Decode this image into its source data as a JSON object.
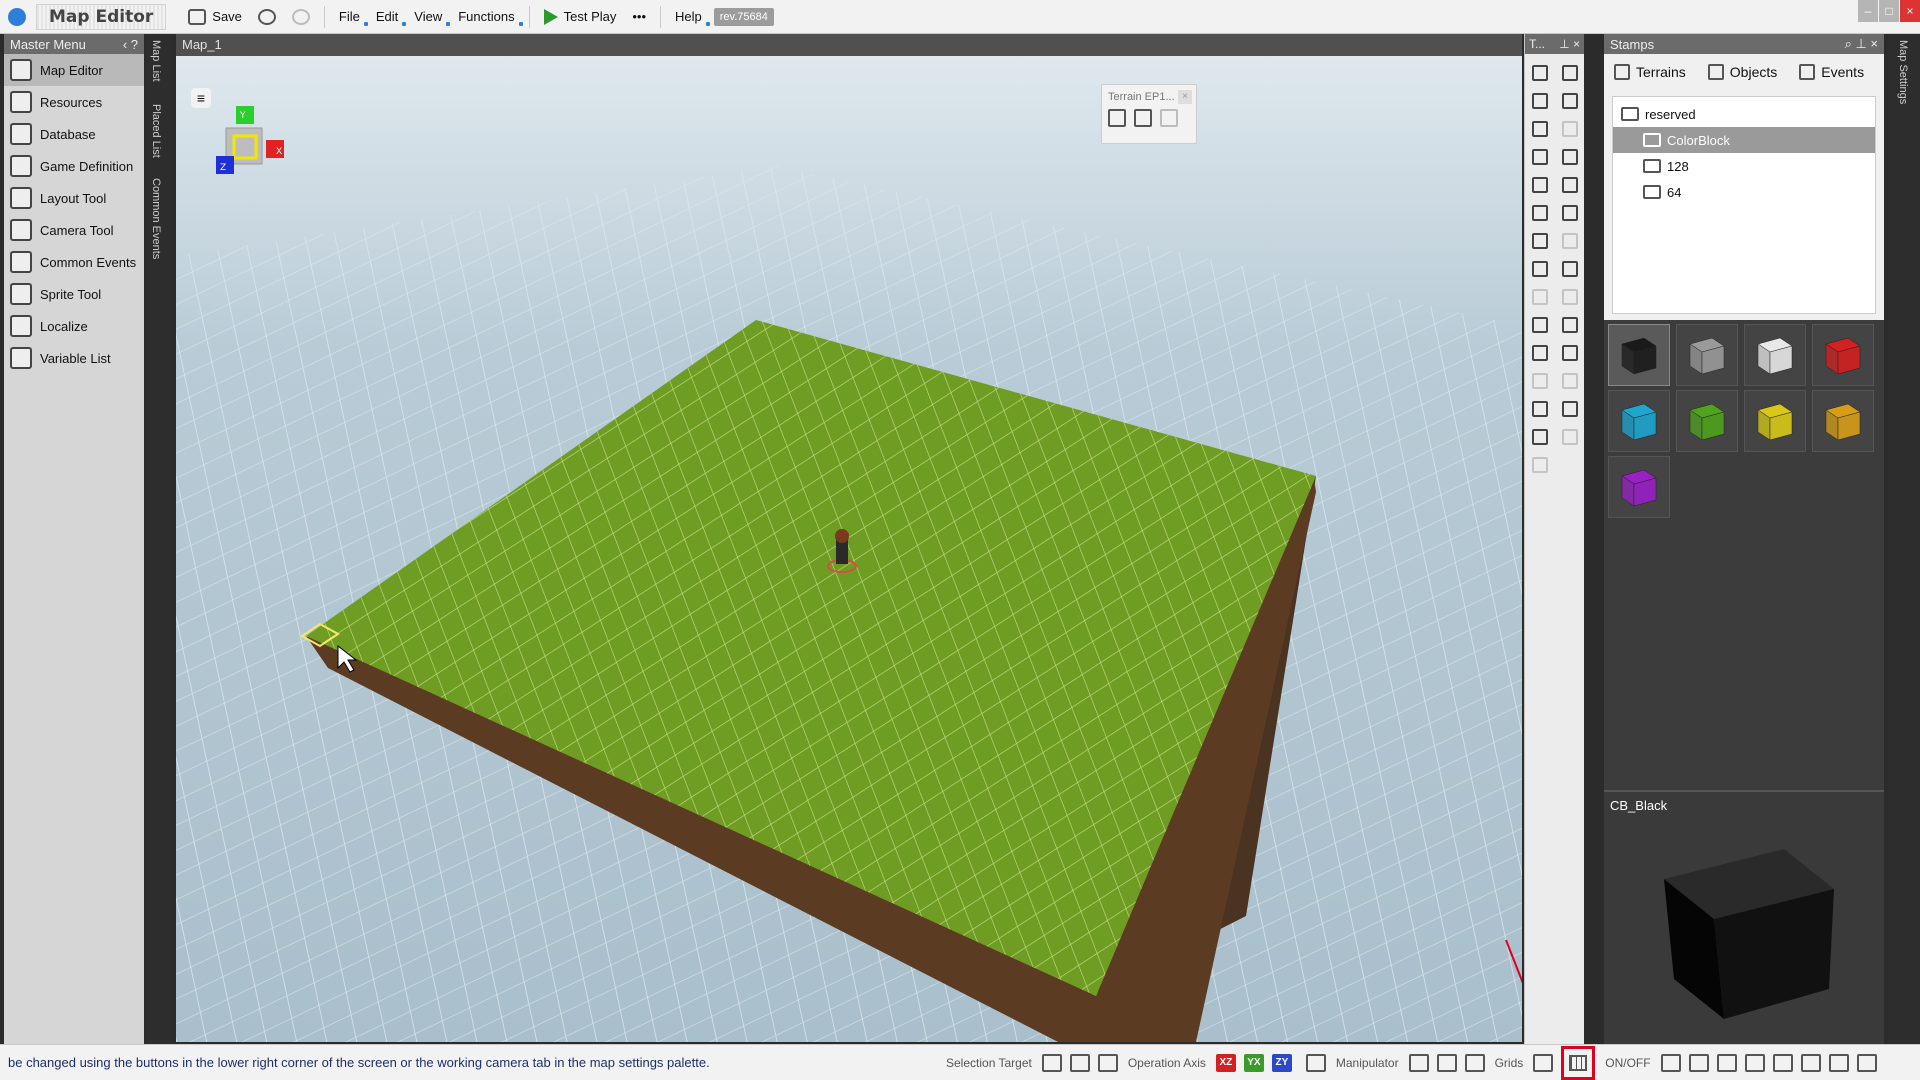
{
  "app": {
    "title": "Map Editor",
    "revision": "rev.75684"
  },
  "toolbar": {
    "save_label": "Save",
    "menus": [
      "File",
      "Edit",
      "View",
      "Functions"
    ],
    "test_play_label": "Test Play",
    "more_label": "•••",
    "help_label": "Help"
  },
  "master_menu": {
    "title": "Master Menu",
    "items": [
      {
        "label": "Map Editor",
        "icon": "map-editor-icon"
      },
      {
        "label": "Resources",
        "icon": "resources-icon"
      },
      {
        "label": "Database",
        "icon": "database-icon"
      },
      {
        "label": "Game Definition",
        "icon": "game-definition-icon"
      },
      {
        "label": "Layout Tool",
        "icon": "layout-tool-icon"
      },
      {
        "label": "Camera Tool",
        "icon": "camera-tool-icon"
      },
      {
        "label": "Common Events",
        "icon": "common-events-icon"
      },
      {
        "label": "Sprite Tool",
        "icon": "sprite-tool-icon"
      },
      {
        "label": "Localize",
        "icon": "localize-icon"
      },
      {
        "label": "Variable List",
        "icon": "variable-list-icon"
      }
    ]
  },
  "side_tabs": [
    "Map List",
    "Placed List",
    "Common Events"
  ],
  "viewport": {
    "tab_label": "Map_1",
    "terrain_popup_title": "Terrain EP1...",
    "gizmo_axes": [
      "X",
      "Y",
      "Z"
    ]
  },
  "tool_palette": {
    "title": "T..."
  },
  "stamps": {
    "title": "Stamps",
    "tabs": [
      "Terrains",
      "Objects",
      "Events"
    ],
    "tree": [
      {
        "label": "reserved",
        "level": 0
      },
      {
        "label": "ColorBlock",
        "level": 1,
        "selected": true
      },
      {
        "label": "128",
        "level": 1
      },
      {
        "label": "64",
        "level": 1
      }
    ],
    "swatches": [
      "#1a1a1a",
      "#9a9a9a",
      "#e8e8e8",
      "#d42020",
      "#1ea6cf",
      "#4fa31d",
      "#d8c917",
      "#d69e17",
      "#9a1fc7"
    ],
    "preview_title": "CB_Black"
  },
  "right_side_tab": "Map Settings",
  "statusbar": {
    "message": "be changed using the buttons in the lower right corner of the screen or the working camera tab in the map settings palette.",
    "selection_target_label": "Selection Target",
    "operation_axis_label": "Operation Axis",
    "axes": [
      "XZ",
      "YX",
      "ZY"
    ],
    "manipulator_label": "Manipulator",
    "grids_label": "Grids",
    "onoff_label": "ON/OFF"
  },
  "colors": {
    "accent_blue": "#2e7fd8",
    "play_green": "#2b9a2b",
    "highlight_red": "#e0001b",
    "grass": "#6f9d24"
  }
}
